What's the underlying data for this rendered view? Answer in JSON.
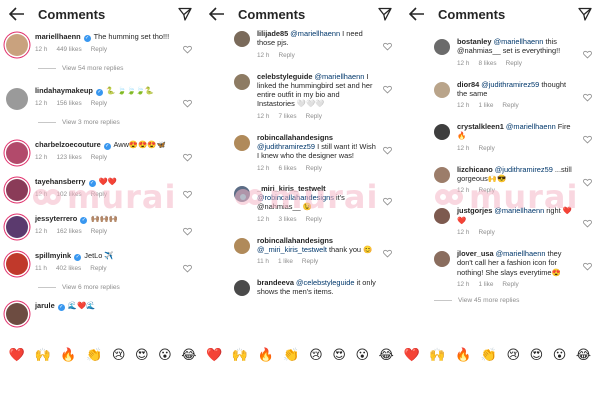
{
  "watermark": "murai",
  "panels": [
    {
      "title": "Comments",
      "items": [
        {
          "kind": "comment",
          "user": "mariellhaenn",
          "verified": true,
          "text": "The humming set tho!!!",
          "time": "12 h",
          "likes": "449 likes",
          "reply": "Reply",
          "avatar_color": "#c9a27e",
          "ring": true
        },
        {
          "kind": "more",
          "label": "View 54 more replies"
        },
        {
          "kind": "comment",
          "user": "lindahaymakeup",
          "verified": true,
          "text": "🐍 🍃🍃🍃🐍",
          "time": "12 h",
          "likes": "156 likes",
          "reply": "Reply",
          "avatar_color": "#9a9a9a",
          "ring": false
        },
        {
          "kind": "more",
          "label": "View 3 more replies"
        },
        {
          "kind": "comment",
          "user": "charbelzoecouture",
          "verified": true,
          "text": "Aww😍😍😍🦋",
          "time": "12 h",
          "likes": "123 likes",
          "reply": "Reply",
          "avatar_color": "#b24a6b",
          "ring": true
        },
        {
          "kind": "comment",
          "user": "tayehansberry",
          "verified": true,
          "text": "❤️❤️",
          "time": "12 h",
          "likes": "102 likes",
          "reply": "Reply",
          "avatar_color": "#8a3b58",
          "ring": true
        },
        {
          "kind": "comment",
          "user": "jessyterrero",
          "verified": true,
          "text": "🙌🏽🙌🏽🙌🏽",
          "time": "12 h",
          "likes": "162 likes",
          "reply": "Reply",
          "avatar_color": "#5b3a6e",
          "ring": true
        },
        {
          "kind": "comment",
          "user": "spillmyink",
          "verified": true,
          "text": "JetLo ✈️",
          "time": "11 h",
          "likes": "402 likes",
          "reply": "Reply",
          "avatar_color": "#c0392b",
          "ring": true
        },
        {
          "kind": "more",
          "label": "View 6 more replies"
        },
        {
          "kind": "comment",
          "user": "jarule",
          "verified": true,
          "text": "🌊❤️🌊",
          "time": "",
          "likes": "",
          "reply": "",
          "avatar_color": "#6d4c41",
          "ring": true
        }
      ]
    },
    {
      "title": "Comments",
      "items": [
        {
          "kind": "comment",
          "user": "lilijade85",
          "verified": false,
          "mention": "@mariellhaenn",
          "text": " I need those pjs.",
          "time": "12 h",
          "likes": "",
          "reply": "Reply",
          "avatar_color": "#7a6a5a",
          "ring": false
        },
        {
          "kind": "comment",
          "user": "celebstyleguide",
          "verified": false,
          "mention": "@mariellhaenn",
          "text": " I linked the hummingbird set and her entire outfit in my bio and Instastories 🤍🤍🤍",
          "time": "12 h",
          "likes": "7 likes",
          "reply": "Reply",
          "avatar_color": "#8d7b63",
          "ring": false
        },
        {
          "kind": "comment",
          "user": "robincallahandesigns",
          "verified": false,
          "mention": "@judithramirez59",
          "text": " I still want it! Wish I knew who the designer was!",
          "time": "12 h",
          "likes": "6 likes",
          "reply": "Reply",
          "avatar_color": "#b08a5a",
          "ring": false
        },
        {
          "kind": "comment",
          "user": "_miri_kiris_testwelt",
          "verified": false,
          "mention": "@robincallahandesigns",
          "text": " it's @nahmias__ 😉",
          "time": "12 h",
          "likes": "3 likes",
          "reply": "Reply",
          "avatar_color": "#5b6c85",
          "ring": false
        },
        {
          "kind": "comment",
          "user": "robincallahandesigns",
          "verified": false,
          "mention": "@_miri_kiris_testwelt",
          "text": " thank you 😊",
          "time": "11 h",
          "likes": "1 like",
          "reply": "Reply",
          "avatar_color": "#b08a5a",
          "ring": false
        },
        {
          "kind": "comment",
          "user": "brandeeva",
          "verified": false,
          "mention": "@celebstyleguide",
          "text": " it only shows the men's items.",
          "time": "",
          "likes": "",
          "reply": "",
          "avatar_color": "#4a4a4a",
          "ring": false
        }
      ]
    },
    {
      "title": "Comments",
      "items": [
        {
          "kind": "comment",
          "user": "bostanley",
          "verified": false,
          "mention": "@mariellhaenn",
          "text": " this @nahmias__ set is everything!!",
          "time": "12 h",
          "likes": "8 likes",
          "reply": "Reply",
          "avatar_color": "#6b6b6b",
          "ring": false
        },
        {
          "kind": "comment",
          "user": "dior84",
          "verified": false,
          "mention": "@judithramirez59",
          "text": " thought the same",
          "time": "12 h",
          "likes": "1 like",
          "reply": "Reply",
          "avatar_color": "#b9a48a",
          "ring": false
        },
        {
          "kind": "comment",
          "user": "crystalkleen1",
          "verified": false,
          "mention": "@mariellhaenn",
          "text": " Fire 🔥",
          "time": "12 h",
          "likes": "",
          "reply": "Reply",
          "avatar_color": "#3e3e3e",
          "ring": false
        },
        {
          "kind": "comment",
          "user": "lizchicano",
          "verified": false,
          "mention": "@judithramirez59",
          "text": " ...still gorgeous🙌😎",
          "time": "12 h",
          "likes": "",
          "reply": "Reply",
          "avatar_color": "#9c7d6a",
          "ring": false
        },
        {
          "kind": "comment",
          "user": "justgorjes",
          "verified": false,
          "mention": "@mariellhaenn",
          "text": " right ❤️❤️",
          "time": "12 h",
          "likes": "",
          "reply": "Reply",
          "avatar_color": "#7d5a4f",
          "ring": false
        },
        {
          "kind": "comment",
          "user": "jlover_usa",
          "verified": false,
          "mention": "@mariellhaenn",
          "text": " they don't call her a fashion icon for nothing! She slays everytime😍",
          "time": "12 h",
          "likes": "1 like",
          "reply": "Reply",
          "avatar_color": "#8a6d5e",
          "ring": false
        },
        {
          "kind": "more",
          "label": "View 45 more replies"
        }
      ]
    }
  ],
  "emoji_bar": [
    "❤️",
    "🙌",
    "🔥",
    "👏",
    "😢",
    "😍",
    "😮",
    "😂"
  ]
}
